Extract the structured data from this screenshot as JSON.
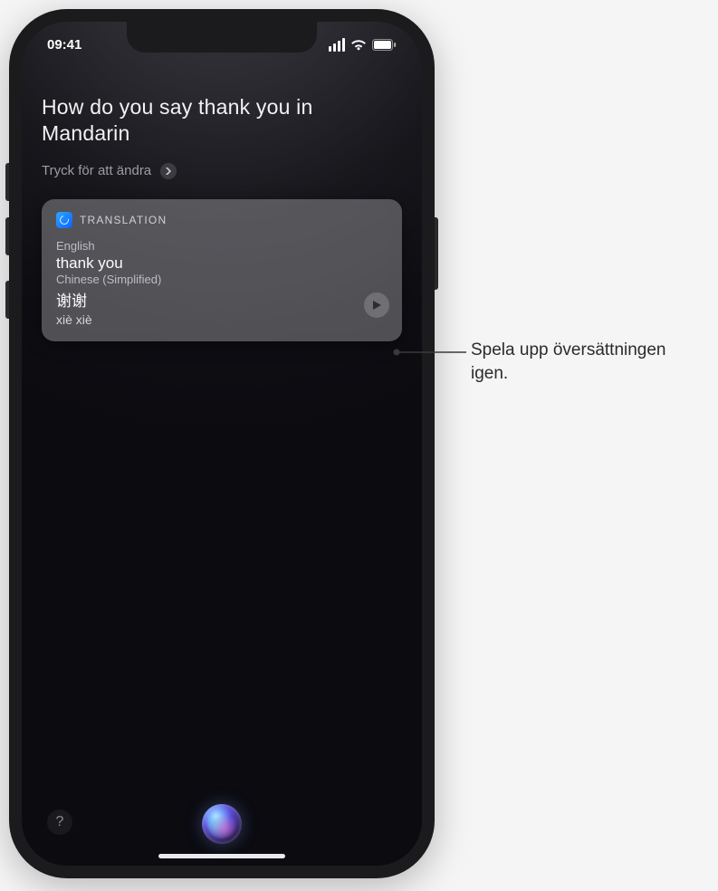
{
  "status_bar": {
    "time": "09:41"
  },
  "siri": {
    "query": "How do you say thank you in Mandarin",
    "edit_hint": "Tryck för att ändra"
  },
  "card": {
    "title": "TRANSLATION",
    "source_lang_label": "English",
    "source_text": "thank you",
    "target_lang_label": "Chinese (Simplified)",
    "target_text": "谢谢",
    "target_pinyin": "xiè xiè"
  },
  "help": {
    "label": "?"
  },
  "callout": {
    "text": "Spela upp översättningen igen."
  }
}
